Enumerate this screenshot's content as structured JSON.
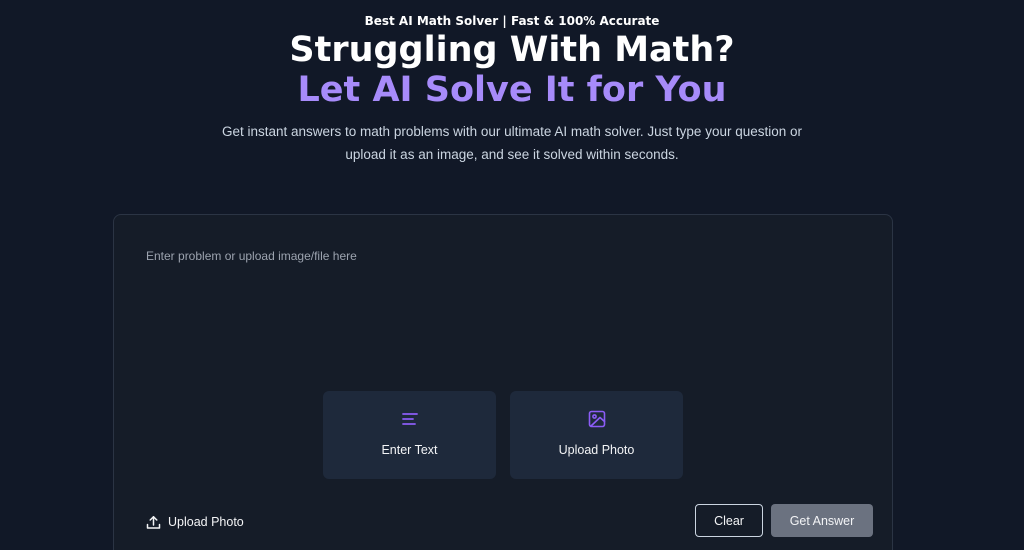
{
  "hero": {
    "tagline": "Best AI Math Solver | Fast & 100% Accurate",
    "headline": "Struggling With Math?",
    "headline_accent": "Let AI Solve It for You",
    "subtitle": "Get instant answers to math problems with our ultimate AI math solver. Just type your question or upload it as an image, and see it solved within seconds."
  },
  "solver": {
    "input_value": "",
    "input_placeholder": "Enter problem or upload image/file here",
    "modes": [
      {
        "label": "Enter Text",
        "icon": "text-lines-icon"
      },
      {
        "label": "Upload Photo",
        "icon": "image-icon"
      }
    ],
    "upload_label": "Upload Photo",
    "upload_icon": "upload-icon",
    "clear_label": "Clear",
    "submit_label": "Get Answer"
  },
  "colors": {
    "background": "#111827",
    "panel": "#151c28",
    "card": "#1e293b",
    "accent": "#a78bfa",
    "icon_accent": "#8b5cf6",
    "submit_button": "#6b7280"
  }
}
